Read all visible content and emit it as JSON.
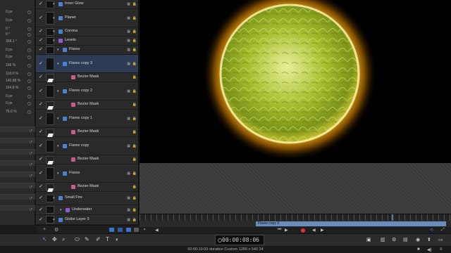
{
  "inspector": {
    "values": [
      "0 px",
      "0 px",
      "0 °",
      "0 °",
      "358.1 °",
      "0 px",
      "0 px",
      "166 %",
      "118.0 %",
      "140.89 %",
      "164.8 %",
      "0 px",
      "0 px",
      "75.0 %"
    ]
  },
  "layers": [
    {
      "name": "Inner Glow",
      "kind": "short",
      "icon": "blue"
    },
    {
      "name": "Planet",
      "kind": "short",
      "icon": "blue"
    },
    {
      "name": "Corona",
      "kind": "short",
      "icon": "blue"
    },
    {
      "name": "Levels",
      "kind": "short",
      "icon": "purple"
    },
    {
      "name": "Flares",
      "kind": "short",
      "icon": "blue"
    },
    {
      "name": "Flares copy 3",
      "kind": "group",
      "icon": "blue",
      "selected": true
    },
    {
      "name": "Bezier Mask",
      "kind": "mask",
      "icon": "pink"
    },
    {
      "name": "Flares copy 2",
      "kind": "group",
      "icon": "blue"
    },
    {
      "name": "Bezier Mask",
      "kind": "mask",
      "icon": "pink"
    },
    {
      "name": "Flares copy 1",
      "kind": "group",
      "icon": "blue"
    },
    {
      "name": "Bezier Mask",
      "kind": "mask",
      "icon": "pink"
    },
    {
      "name": "Flares copy",
      "kind": "group",
      "icon": "blue"
    },
    {
      "name": "Bezier Mask",
      "kind": "mask",
      "icon": "pink"
    },
    {
      "name": "Flares",
      "kind": "group",
      "icon": "blue"
    },
    {
      "name": "Bezier Mask",
      "kind": "mask",
      "icon": "pink"
    },
    {
      "name": "Small Fire",
      "kind": "group",
      "icon": "blue"
    },
    {
      "name": "Underwater",
      "kind": "short",
      "icon": "purple"
    },
    {
      "name": "Globe Layer 3",
      "kind": "short",
      "icon": "blue"
    }
  ],
  "timeline": {
    "clip_label": "Flares copy 3",
    "timecode": "00:00:08:06"
  },
  "status": {
    "text": "00:00:10:00 duration Custom 1280 x 540 24"
  },
  "colors": {
    "accent": "#4a82d6",
    "selected_row": "#2e3b55",
    "clip_bar": "#6a8dbf",
    "sun_core": "#9fb82a",
    "sun_glow": "#ffb400"
  }
}
